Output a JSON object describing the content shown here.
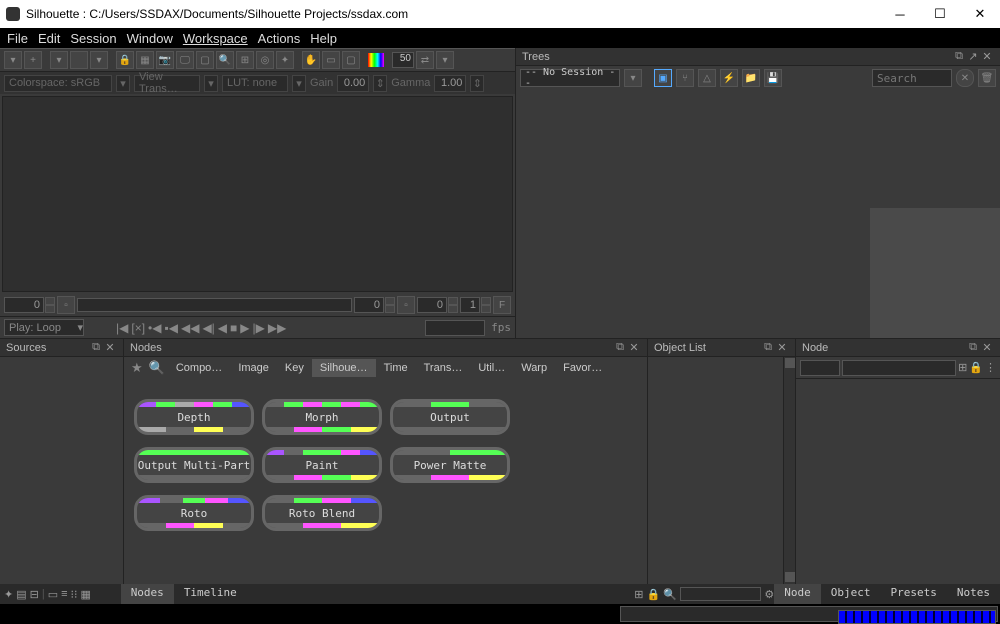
{
  "title": "Silhouette : C:/Users/SSDAX/Documents/Silhouette Projects/ssdax.com",
  "menu": [
    "File",
    "Edit",
    "Session",
    "Window",
    "Workspace",
    "Actions",
    "Help"
  ],
  "toolbar": {
    "zoom": "50"
  },
  "subtoolbar": {
    "colorspace": "Colorspace: sRGB",
    "viewtrans": "View Trans…",
    "lut": "LUT: none",
    "gain_label": "Gain",
    "gain_val": "0.00",
    "gamma_label": "Gamma",
    "gamma_val": "1.00"
  },
  "viewer": {
    "v1": "0",
    "v2": "0",
    "v3": "0",
    "v4": "1"
  },
  "play": {
    "mode": "Play: Loop",
    "fps": "fps"
  },
  "trees": {
    "title": "Trees",
    "session": "-- No Session --",
    "search": "Search"
  },
  "sources": {
    "title": "Sources"
  },
  "nodes": {
    "title": "Nodes",
    "tabs": [
      "Compo…",
      "Image",
      "Key",
      "Silhoue…",
      "Time",
      "Trans…",
      "Util…",
      "Warp",
      "Favor…"
    ],
    "items": [
      "Depth",
      "Morph",
      "Output",
      "Output Multi-Part",
      "Paint",
      "Power Matte",
      "Roto",
      "Roto Blend"
    ]
  },
  "objlist": {
    "title": "Object List"
  },
  "nodepanel": {
    "title": "Node"
  },
  "bottom_tabs_left": [
    "Nodes",
    "Timeline"
  ],
  "bottom_tabs_right": [
    "Node",
    "Object",
    "Presets",
    "Notes"
  ]
}
